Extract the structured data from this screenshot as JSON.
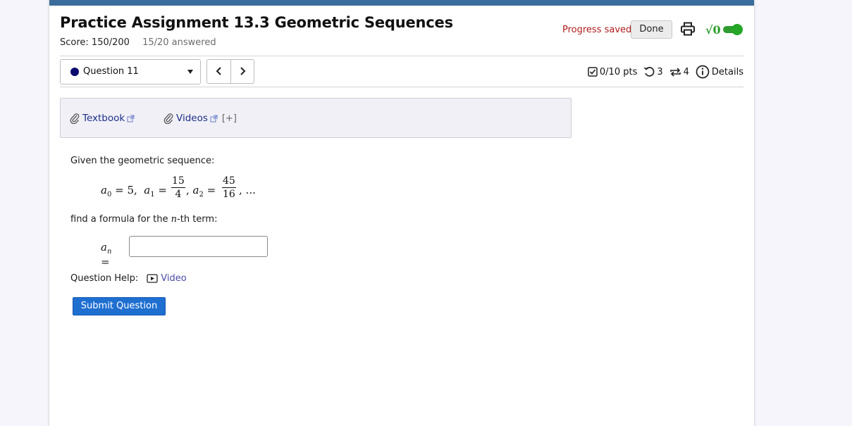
{
  "header": {
    "title": "Practice Assignment 13.3 Geometric Sequences",
    "score": "Score: 150/200",
    "answered": "15/20 answered",
    "progress_saved": "Progress saved",
    "done_label": "Done",
    "math_toggle_symbol": "√0"
  },
  "question_nav": {
    "selected_question": "Question 11",
    "prev_symbol": "‹",
    "next_symbol": "›"
  },
  "stats": {
    "points": "0/10 pts",
    "retries": "3",
    "attempts": "4",
    "details_label": "Details"
  },
  "resources": {
    "textbook_label": "Textbook",
    "videos_label": "Videos",
    "expand_label": "[+]"
  },
  "question": {
    "intro": "Given the geometric sequence:",
    "a0_value": "5",
    "a1_num": "15",
    "a1_den": "4",
    "a2_num": "45",
    "a2_den": "16",
    "ellipsis": "...",
    "prompt_before": "find a formula for the ",
    "prompt_var": "n",
    "prompt_after": "-th term:",
    "answer_value": ""
  },
  "help": {
    "label": "Question Help:",
    "video_label": "Video"
  },
  "submit_label": "Submit Question",
  "colors": {
    "topbar": "#3a6d9c",
    "progress_saved": "#b01c1c",
    "toggle_green": "#26a626",
    "submit_blue": "#1f6fd1"
  }
}
